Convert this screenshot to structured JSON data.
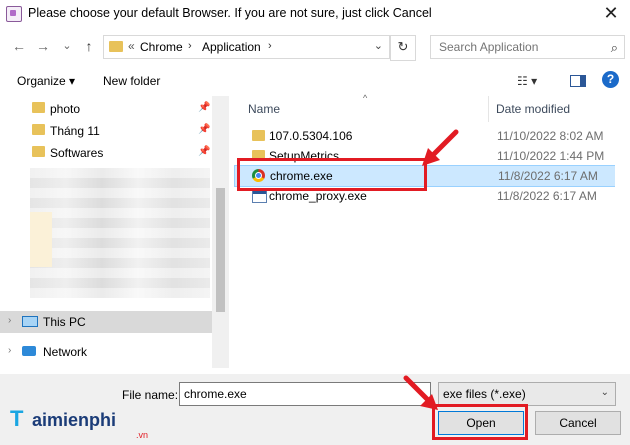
{
  "window": {
    "title": "Please choose your default Browser. If you are not sure, just click Cancel",
    "close_glyph": "✕"
  },
  "nav": {
    "back": "←",
    "forward": "→",
    "recent": "⌄",
    "up": "↑",
    "address": {
      "prefix": "«",
      "crumbs": [
        "Chrome",
        "Application"
      ],
      "separator": "›",
      "dropdown": "⌄"
    },
    "refresh": "↻",
    "search_placeholder": "Search Application",
    "search_icon": "⌕"
  },
  "toolbar": {
    "organize": "Organize ▾",
    "new_folder": "New folder",
    "view": "☷ ▾",
    "help": "?"
  },
  "sidebar": {
    "quick": [
      {
        "label": "photo",
        "icon": "folder-icon",
        "pinned": true
      },
      {
        "label": "Tháng 11",
        "icon": "folder-icon",
        "pinned": true
      },
      {
        "label": "Softwares",
        "icon": "folder-icon",
        "pinned": true
      }
    ],
    "this_pc": "This PC",
    "network": "Network",
    "expand_glyph": "›",
    "pin_glyph": "📌"
  },
  "columns": {
    "name": "Name",
    "date": "Date modified",
    "sort": "^"
  },
  "files": [
    {
      "name": "107.0.5304.106",
      "date": "11/10/2022 8:02 AM",
      "type": "folder"
    },
    {
      "name": "SetupMetrics",
      "date": "11/10/2022 1:44 PM",
      "type": "folder"
    },
    {
      "name": "chrome.exe",
      "date": "11/8/2022 6:17 AM",
      "type": "chrome",
      "selected": true
    },
    {
      "name": "chrome_proxy.exe",
      "date": "11/8/2022 6:17 AM",
      "type": "exe"
    }
  ],
  "bottom": {
    "file_name_label": "File name:",
    "file_name_value": "chrome.exe",
    "filter": "exe files (*.exe)",
    "filter_drop": "⌄",
    "open": "Open",
    "cancel": "Cancel"
  },
  "watermark": {
    "first": "T",
    "rest": "aimienphi",
    "domain": ".vn"
  },
  "colors": {
    "highlight": "#e21b23",
    "selection": "#cce8ff",
    "accent": "#0078d7"
  }
}
